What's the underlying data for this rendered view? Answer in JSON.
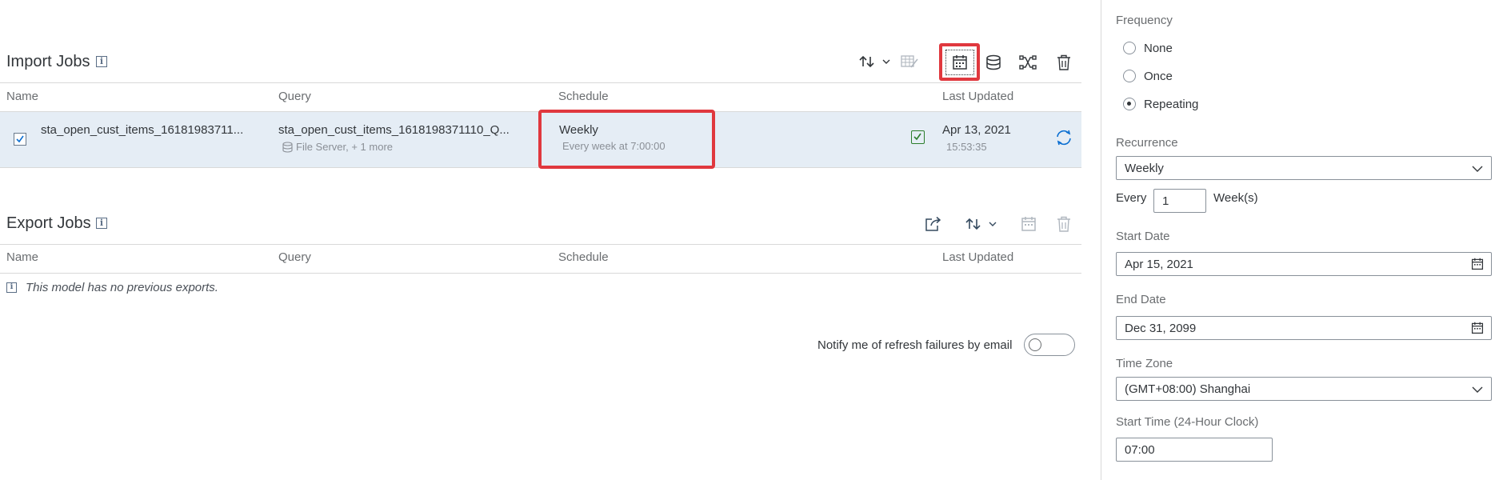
{
  "import_jobs": {
    "title": "Import Jobs",
    "columns": [
      "Name",
      "Query",
      "Schedule",
      "Last Updated"
    ],
    "row": {
      "name": "sta_open_cust_items_16181983711...",
      "query": "sta_open_cust_items_1618198371110_Q...",
      "query_source": "File Server, + 1 more",
      "schedule": "Weekly",
      "schedule_detail": "Every week at 7:00:00",
      "last_updated_date": "Apr 13, 2021",
      "last_updated_time": "15:53:35"
    }
  },
  "export_jobs": {
    "title": "Export Jobs",
    "columns": [
      "Name",
      "Query",
      "Schedule",
      "Last Updated"
    ],
    "empty_message": "This model has no previous exports."
  },
  "notify": {
    "label": "Notify me of refresh failures by email"
  },
  "panel": {
    "frequency_label": "Frequency",
    "frequency_options": [
      "None",
      "Once",
      "Repeating"
    ],
    "frequency_selected": "Repeating",
    "recurrence_label": "Recurrence",
    "recurrence_value": "Weekly",
    "every_label": "Every",
    "every_value": "1",
    "every_unit": "Week(s)",
    "start_date_label": "Start Date",
    "start_date_value": "Apr 15, 2021",
    "end_date_label": "End Date",
    "end_date_value": "Dec 31, 2099",
    "timezone_label": "Time Zone",
    "timezone_value": "(GMT+08:00) Shanghai",
    "start_time_label": "Start Time (24-Hour Clock)",
    "start_time_value": "07:00"
  },
  "colors": {
    "highlight_red": "#e0383e",
    "row_selected_bg": "#e5edf5",
    "icon_blue": "#0a6ed1",
    "success_green": "#2b7d2b"
  }
}
